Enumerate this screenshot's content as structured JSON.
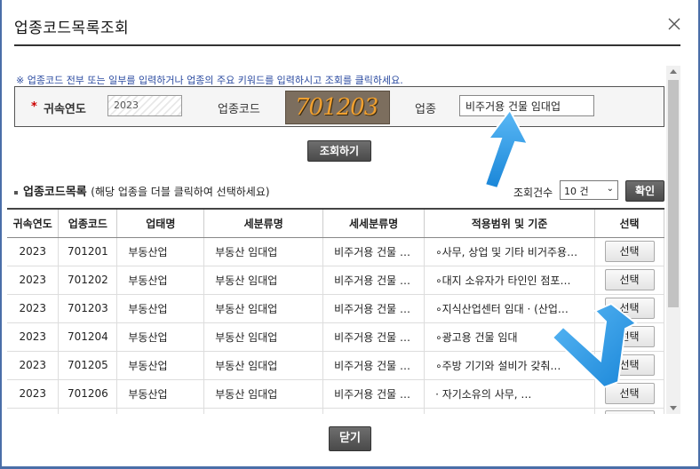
{
  "dialog": {
    "title": "업종코드목록조회"
  },
  "search": {
    "notice": "※ 업종코드 전부 또는 일부를 입력하거나 업종의 주요 키워드를 입력하시고 조회를 클릭하세요.",
    "required_mark": "*",
    "year_label": "귀속연도",
    "year_value": "2023",
    "code_label": "업종코드",
    "code_value": "701203",
    "biz_label": "업종",
    "biz_value": "비주거용 건물 임대업",
    "search_button": "조회하기"
  },
  "list": {
    "title": "업종코드목록",
    "hint": "(해당 업종을 더블 클릭하여 선택하세요)",
    "count_label": "조회건수",
    "count_value": "10 건",
    "ok_button": "확인",
    "columns": [
      "귀속연도",
      "업종코드",
      "업태명",
      "세분류명",
      "세세분류명",
      "적용범위 및 기준",
      "선택"
    ],
    "rows": [
      {
        "year": "2023",
        "code": "701201",
        "type": "부동산업",
        "sub": "부동산 임대업",
        "subsub": "비주거용 건물 …",
        "scope": "∘사무, 상업 및 기타 비거주용…",
        "select": "선택"
      },
      {
        "year": "2023",
        "code": "701202",
        "type": "부동산업",
        "sub": "부동산 임대업",
        "subsub": "비주거용 건물 …",
        "scope": "∘대지 소유자가 타인인 점포…",
        "select": "선택"
      },
      {
        "year": "2023",
        "code": "701203",
        "type": "부동산업",
        "sub": "부동산 임대업",
        "subsub": "비주거용 건물 …",
        "scope": "∘지식산업센터 임대 · (산업…",
        "select": "선택"
      },
      {
        "year": "2023",
        "code": "701204",
        "type": "부동산업",
        "sub": "부동산 임대업",
        "subsub": "비주거용 건물 …",
        "scope": "∘광고용 건물 임대",
        "select": "선택"
      },
      {
        "year": "2023",
        "code": "701205",
        "type": "부동산업",
        "sub": "부동산 임대업",
        "subsub": "비주거용 건물 …",
        "scope": "∘주방 기기와 설비가 갖춰…",
        "select": "선택"
      },
      {
        "year": "2023",
        "code": "701206",
        "type": "부동산업",
        "sub": "부동산 임대업",
        "subsub": "비주거용 건물 …",
        "scope": "· 자기소유의 사무, …",
        "select": "선택"
      }
    ]
  },
  "footer": {
    "close_button": "닫기"
  },
  "colors": {
    "frame": "#4a6ea8",
    "notice_text": "#2a4aa0",
    "arrow_blue": "#2a9be8"
  },
  "icons": {
    "close": "close-icon",
    "dropdown": "chevron-down-icon",
    "pointer_arrows": "pointer-arrow-icon"
  }
}
